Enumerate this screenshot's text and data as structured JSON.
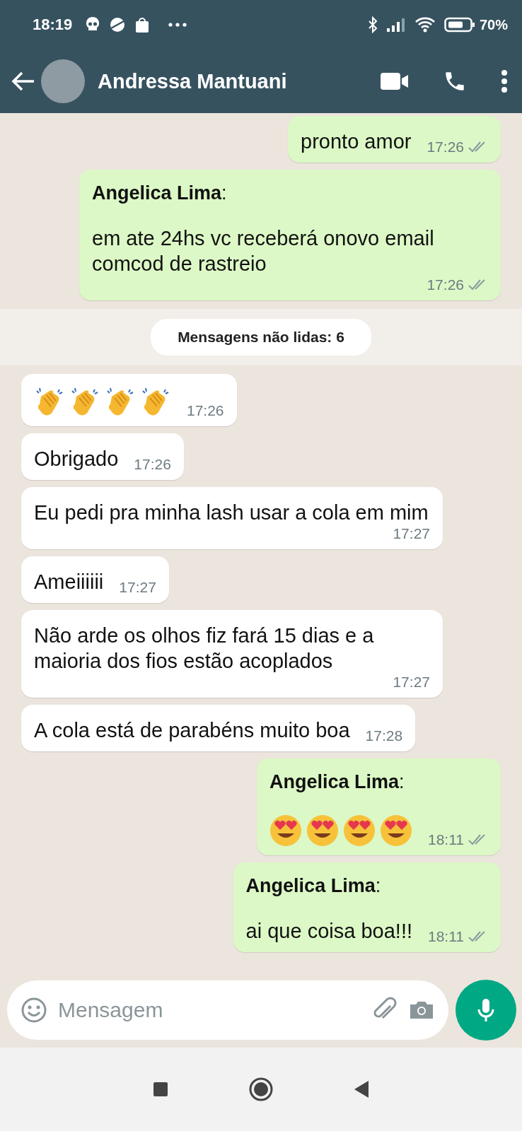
{
  "status_bar": {
    "time": "18:19",
    "battery": "70%"
  },
  "header": {
    "contact_name": "Andressa Mantuani"
  },
  "messages": [
    {
      "kind": "text",
      "outgoing": true,
      "text": "pronto amor",
      "time": "17:26",
      "read": false
    },
    {
      "kind": "text",
      "outgoing": true,
      "sender": "**Angelica Lima**:",
      "text": "em ate 24hs vc receberá onovo email comcod de rastreio",
      "time": "17:26",
      "read": false
    },
    {
      "kind": "banner",
      "text": "Mensagens não lidas: 6"
    },
    {
      "kind": "emoji",
      "outgoing": false,
      "emojis": [
        {
          "kind": "clap"
        },
        {
          "kind": "clap"
        },
        {
          "kind": "clap"
        },
        {
          "kind": "clap"
        }
      ],
      "time": "17:26"
    },
    {
      "kind": "text",
      "outgoing": false,
      "text": "Obrigado",
      "time": "17:26"
    },
    {
      "kind": "text",
      "outgoing": false,
      "text": "Eu pedi pra minha lash usar a cola em mim",
      "time": "17:27"
    },
    {
      "kind": "text",
      "outgoing": false,
      "text": "Ameiiiiii",
      "time": "17:27"
    },
    {
      "kind": "text",
      "outgoing": false,
      "text": "Não arde os olhos fiz fará 15 dias e a maioria dos fios estão acoplados",
      "time": "17:27"
    },
    {
      "kind": "text",
      "outgoing": false,
      "text": "A cola está de parabéns muito boa",
      "time": "17:28"
    },
    {
      "kind": "emoji",
      "outgoing": true,
      "sender": "**Angelica Lima**:",
      "emojis": [
        {
          "kind": "heart-eyes"
        },
        {
          "kind": "heart-eyes"
        },
        {
          "kind": "heart-eyes"
        },
        {
          "kind": "heart-eyes"
        }
      ],
      "time": "18:11",
      "read": false
    },
    {
      "kind": "text",
      "outgoing": true,
      "sender": "**Angelica Lima**:",
      "text": "ai que coisa boa!!!",
      "time": "18:11",
      "read": false
    }
  ],
  "composer": {
    "placeholder": "Mensagem"
  }
}
